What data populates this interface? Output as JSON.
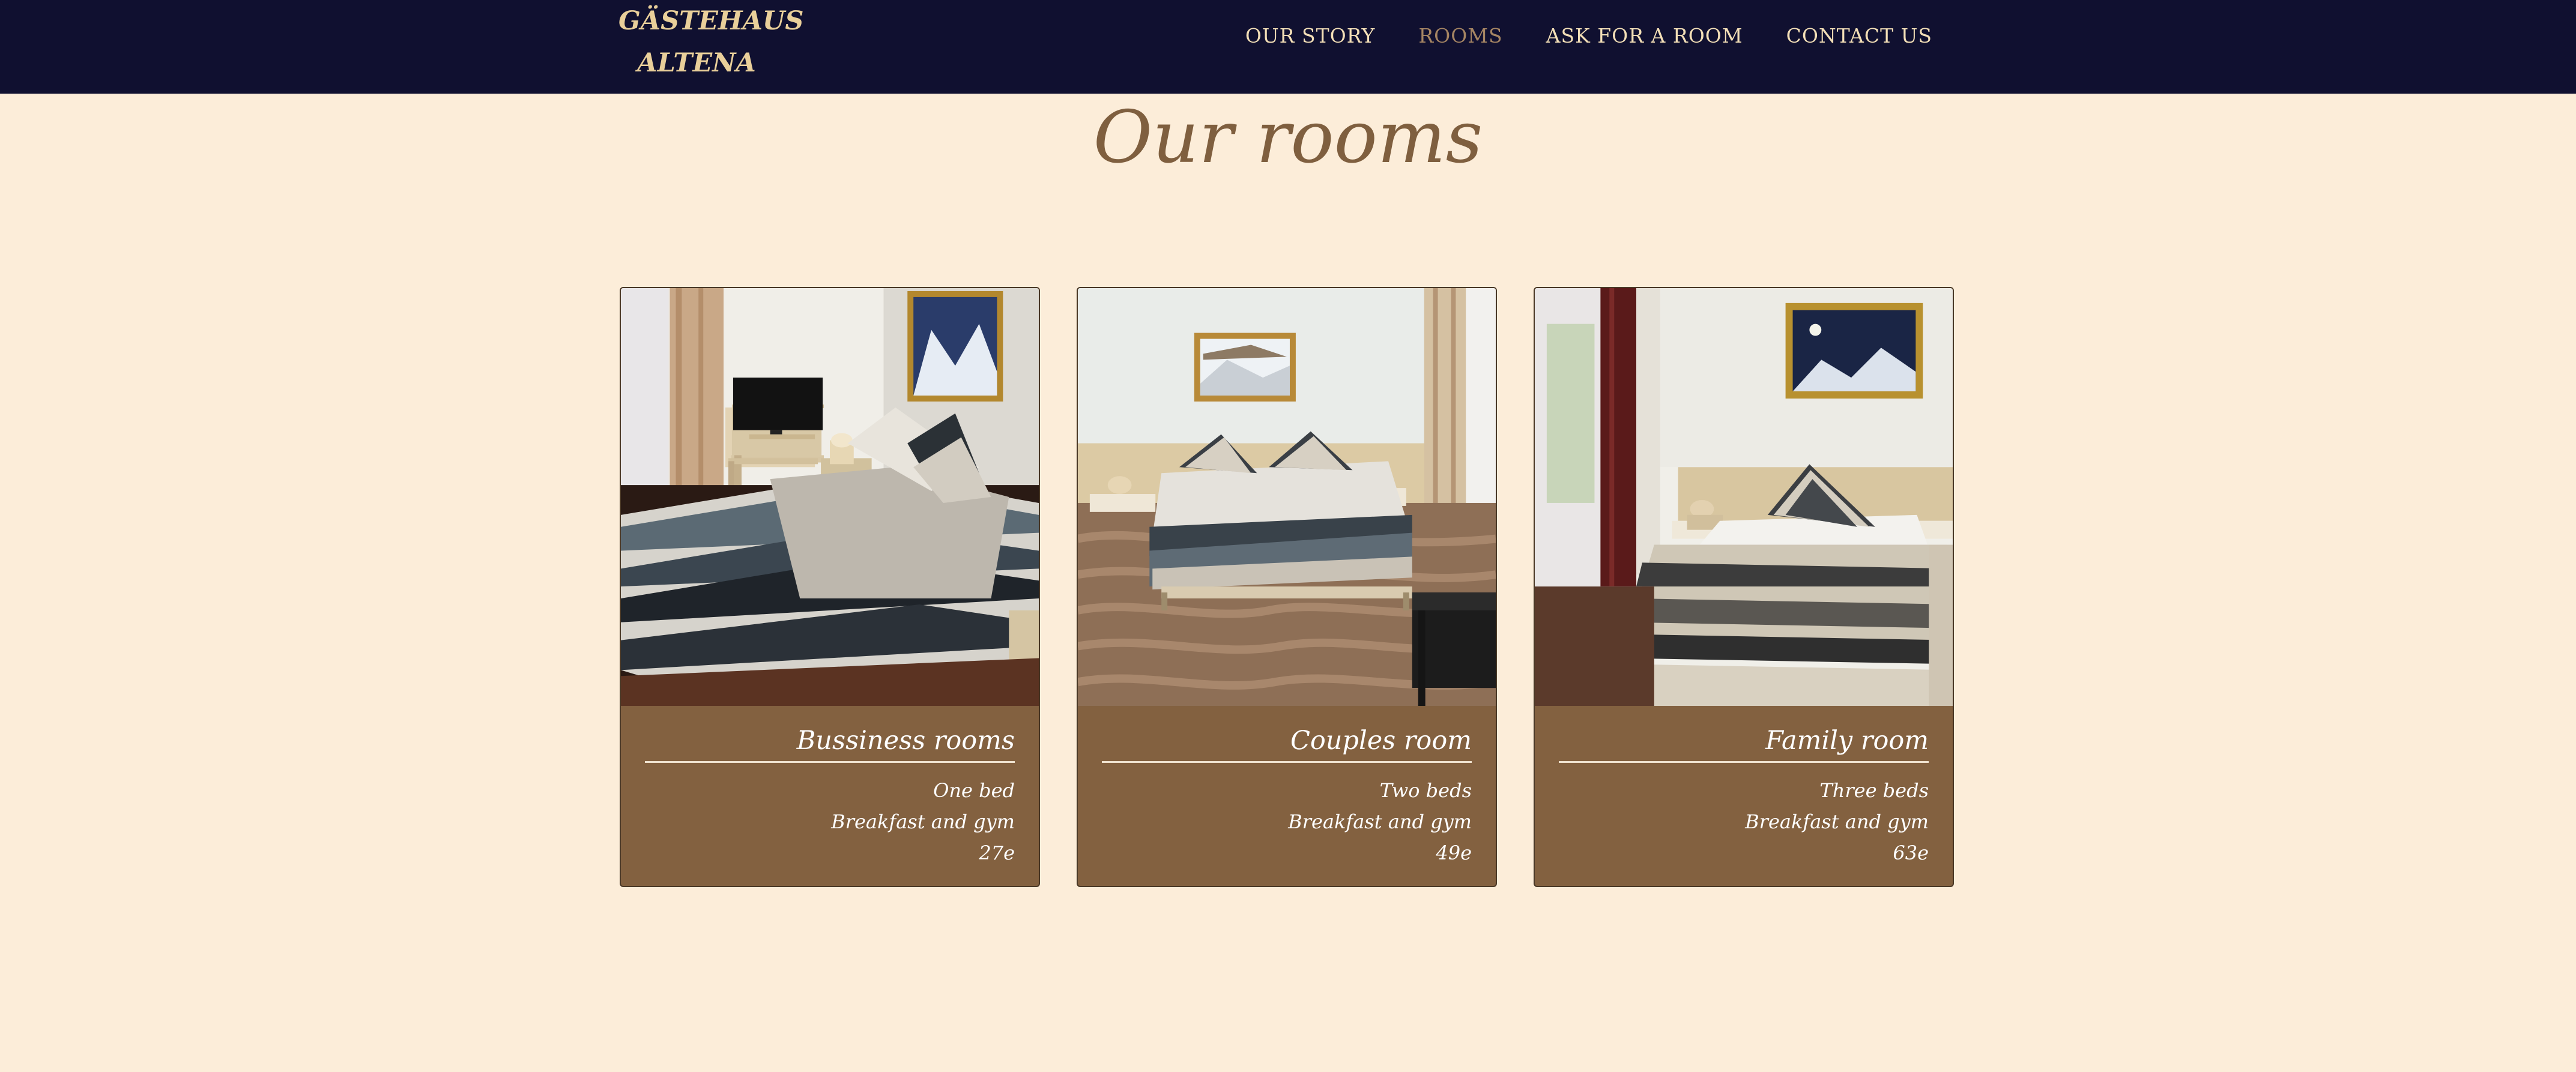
{
  "nav": {
    "brand_line1": "GÄSTEHAUS",
    "brand_line2": "ALTENA",
    "links": [
      {
        "label": "OUR STORY",
        "active": false
      },
      {
        "label": "ROOMS",
        "active": true
      },
      {
        "label": "ASK FOR A ROOM",
        "active": false
      },
      {
        "label": "CONTACT US",
        "active": false
      }
    ]
  },
  "page": {
    "title": "Our rooms"
  },
  "rooms": [
    {
      "title": "Bussiness rooms",
      "beds": "One bed",
      "extras": "Breakfast and gym",
      "price": "27e"
    },
    {
      "title": "Couples room",
      "beds": "Two beds",
      "extras": "Breakfast and gym",
      "price": "49e"
    },
    {
      "title": "Family room",
      "beds": "Three beds",
      "extras": "Breakfast and gym",
      "price": "63e"
    }
  ],
  "colors": {
    "navbar_bg": "#101030",
    "brand": "#e9cf9a",
    "nav_text": "#f3dfb7",
    "nav_active": "#a58563",
    "page_bg": "#fcedd9",
    "title": "#7f5f3f",
    "card_bg": "#836140"
  }
}
